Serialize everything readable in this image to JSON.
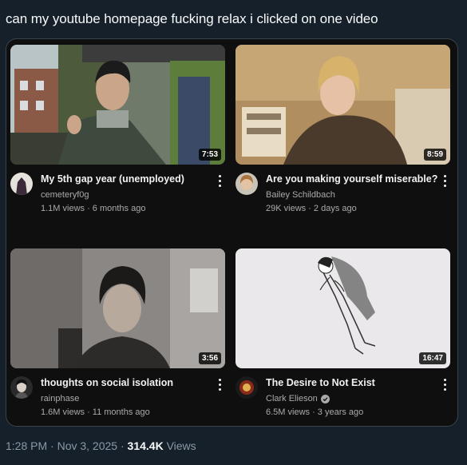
{
  "tweet": {
    "text": "can my youtube homepage fucking relax i clicked on one video",
    "timestamp": "1:28 PM · Nov 3, 2025 · ",
    "views_count": "314.4K",
    "views_label": " Views"
  },
  "videos": [
    {
      "title": "My 5th gap year (unemployed)",
      "channel": "cemeteryf0g",
      "meta": "1.1M views · 6 months ago",
      "duration": "7:53",
      "verified": false
    },
    {
      "title": "Are you making yourself miserable?",
      "channel": "Bailey Schildbach",
      "meta": "29K views · 2 days ago",
      "duration": "8:59",
      "verified": false
    },
    {
      "title": "thoughts on social isolation",
      "channel": "rainphase",
      "meta": "1.6M views · 11 months ago",
      "duration": "3:56",
      "verified": false
    },
    {
      "title": "The Desire to Not Exist",
      "channel": "Clark Elieson",
      "meta": "6.5M views · 3 years ago",
      "duration": "16:47",
      "verified": true
    }
  ],
  "colors": {
    "page_bg": "#15202b",
    "card_bg": "#0f0f0f",
    "secondary_text": "#aaaaaa"
  }
}
